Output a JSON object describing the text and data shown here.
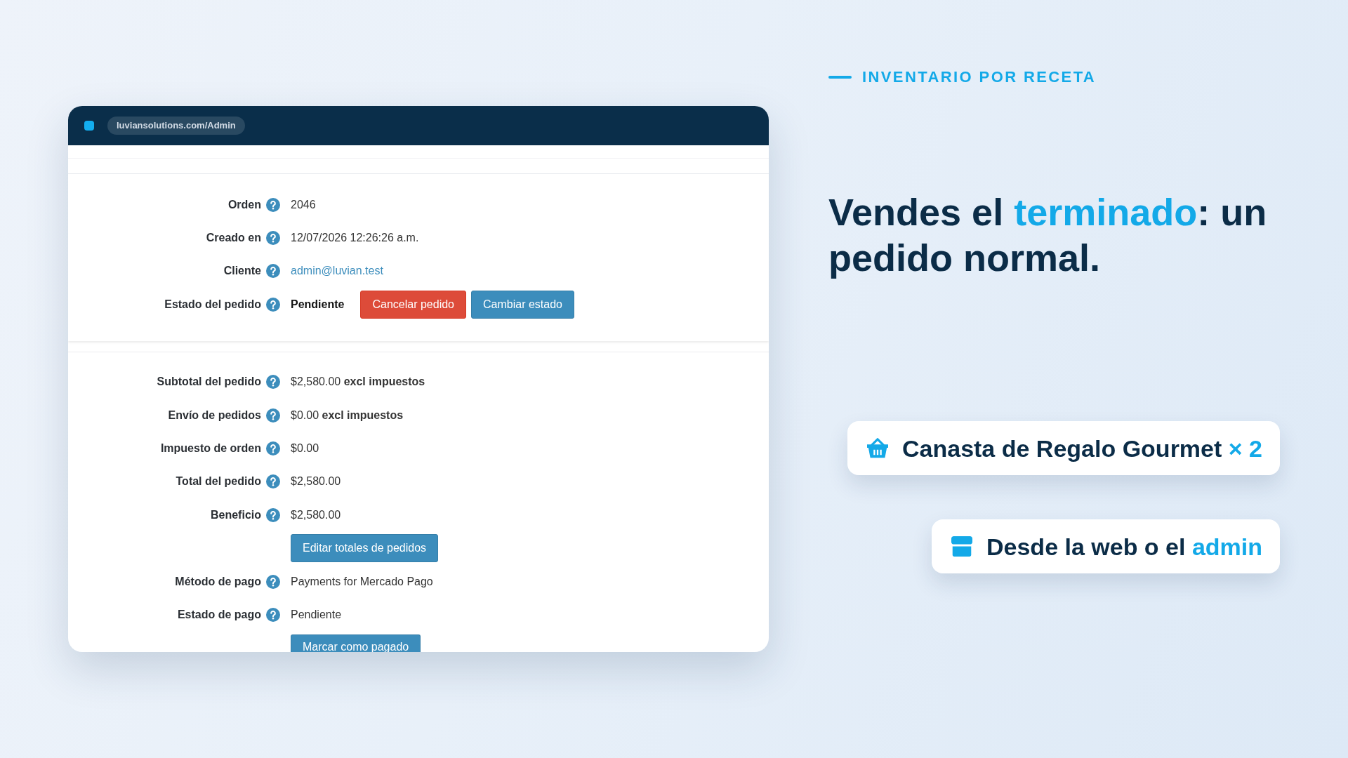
{
  "browser": {
    "url": "luviansolutions.com/Admin"
  },
  "order_panel": {
    "rows": [
      {
        "label": "Orden",
        "kind": "text",
        "value": "2046"
      },
      {
        "label": "Creado en",
        "kind": "text",
        "value": "12/07/2026 12:26:26 a.m."
      },
      {
        "label": "Cliente",
        "kind": "link",
        "value": "admin@luvian.test"
      },
      {
        "label": "Estado del pedido",
        "kind": "status",
        "value": "Pendiente",
        "buttons": [
          {
            "label": "Cancelar pedido",
            "kind": "danger"
          },
          {
            "label": "Cambiar estado",
            "kind": "primary"
          }
        ]
      }
    ]
  },
  "totals_panel": {
    "rows": [
      {
        "label": "Subtotal del pedido",
        "kind": "text",
        "value": "$2,580.00 **excl impuestos**"
      },
      {
        "label": "Envío de pedidos",
        "kind": "text",
        "value": "$0.00 **excl impuestos**"
      },
      {
        "label": "Impuesto de orden",
        "kind": "text",
        "value": "$0.00"
      },
      {
        "label": "Total del pedido",
        "kind": "text",
        "value": "$2,580.00"
      },
      {
        "label": "Beneficio",
        "kind": "text",
        "value": "$2,580.00"
      },
      {
        "kind": "actions",
        "buttons": [
          {
            "label": "Editar totales de pedidos",
            "kind": "primary"
          }
        ]
      },
      {
        "label": "Método de pago",
        "kind": "text",
        "value": "Payments for Mercado Pago"
      },
      {
        "label": "Estado de pago",
        "kind": "text",
        "value": "Pendiente"
      },
      {
        "kind": "actions",
        "buttons": [
          {
            "label": "Marcar como pagado",
            "kind": "primary"
          }
        ]
      }
    ]
  },
  "eyebrow": "INVENTARIO POR RECETA",
  "headline": [
    {
      "text": "Vendes el ",
      "highlight": false
    },
    {
      "text": "terminado",
      "highlight": true
    },
    {
      "text": ": un pedido normal.",
      "highlight": false
    }
  ],
  "cards": [
    {
      "kind": "product",
      "parts": [
        {
          "text": "Canasta de Regalo Gourmet ",
          "highlight": false
        },
        {
          "text": "× 2",
          "highlight": true
        }
      ]
    },
    {
      "kind": "source",
      "parts": [
        {
          "text": "Desde la web o el ",
          "highlight": false
        },
        {
          "text": "admin",
          "highlight": true
        }
      ]
    }
  ]
}
